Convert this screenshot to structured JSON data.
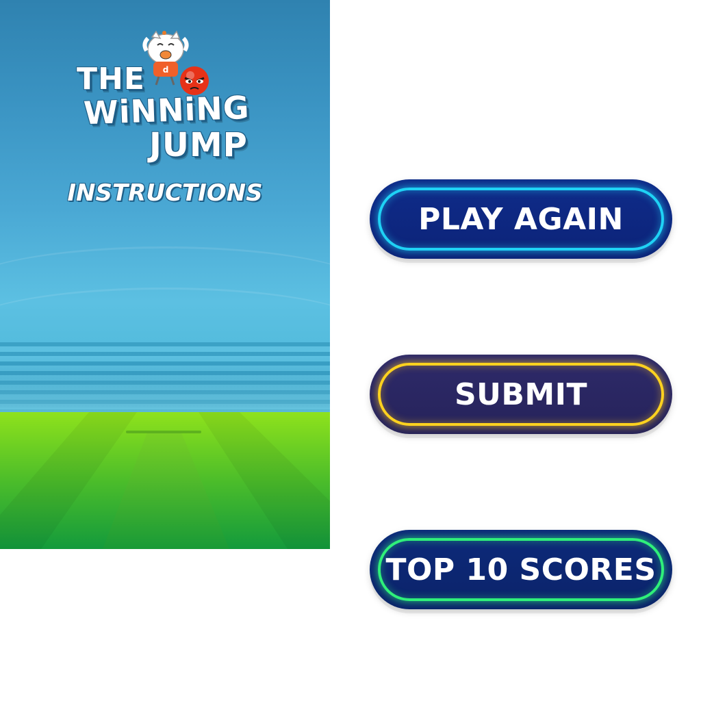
{
  "game": {
    "title_line1": "THE",
    "title_line2": "WiNNiNG",
    "title_line3": "JUMP",
    "instructions_label": "INSTRUCTIONS"
  },
  "buttons": {
    "play_again": "PLAY AGAIN",
    "submit": "SUBMIT",
    "top_scores": "TOP 10 SCORES"
  },
  "colors": {
    "play_again_glow": "#1fd2f5",
    "submit_glow": "#ffd21f",
    "top_scores_glow": "#2ff07a",
    "button_base": "#0f2c8a",
    "sky_top": "#2f82b0",
    "grass": "#6fd321"
  },
  "icons": {
    "mascot": "cat-mascot-icon",
    "ball": "angry-ball-icon"
  }
}
